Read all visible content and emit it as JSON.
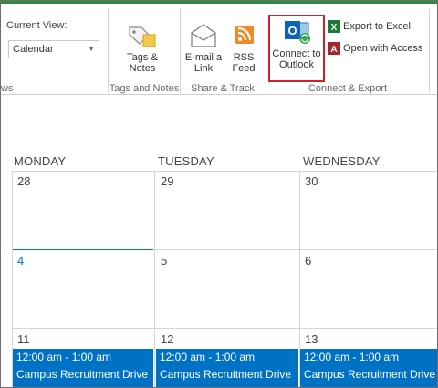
{
  "ribbon": {
    "current_view_label": "Current View:",
    "current_view_value": "Calendar",
    "left_group_label": "ws",
    "tags_notes": {
      "label_line1": "Tags &",
      "label_line2": "Notes",
      "group": "Tags and Notes"
    },
    "share_track": {
      "email_link": {
        "line1": "E-mail a",
        "line2": "Link"
      },
      "rss_feed": {
        "line1": "RSS",
        "line2": "Feed"
      },
      "group": "Share & Track"
    },
    "connect_export": {
      "connect_outlook": {
        "line1": "Connect to",
        "line2": "Outlook"
      },
      "export_excel": "Export to Excel",
      "open_access": "Open with Access",
      "group": "Connect & Export"
    }
  },
  "calendar": {
    "days": [
      "MONDAY",
      "TUESDAY",
      "WEDNESDAY"
    ],
    "week1": [
      "28",
      "29",
      "30"
    ],
    "week2": [
      "4",
      "5",
      "6"
    ],
    "week3": [
      "11",
      "12",
      "13"
    ],
    "events": [
      {
        "time": "12:00 am - 1:00 am",
        "title": "Campus Recruitment Drive"
      },
      {
        "time": "12:00 am - 1:00 am",
        "title": "Campus Recruitment Drive"
      },
      {
        "time": "12:00 am - 1:00 am",
        "title": "Campus Recruitment Drive"
      }
    ]
  },
  "colors": {
    "event_bg": "#0072c6",
    "highlight_border": "#d21f2b",
    "ribbon_accent": "#2e8b3a",
    "today_accent": "#0072c6"
  }
}
